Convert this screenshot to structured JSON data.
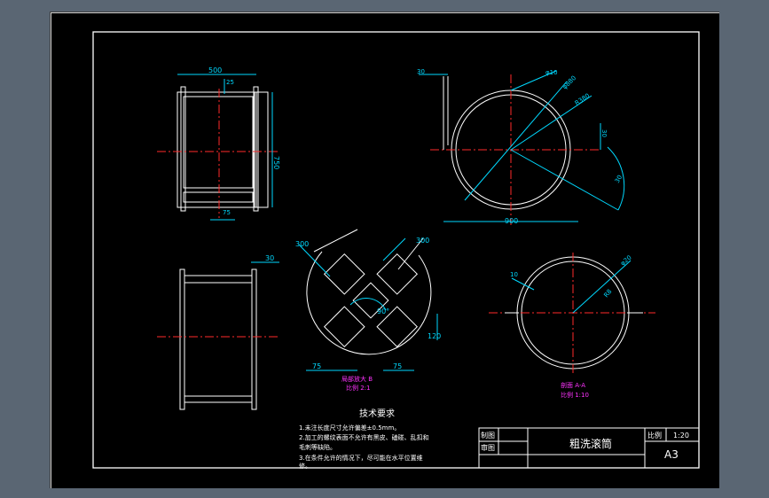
{
  "title_block": {
    "part_name": "粗洗滚筒",
    "drawn_label": "制图",
    "checked_label": "审图",
    "scale_label": "比例",
    "scale_value": "1:20",
    "sheet_size": "A3"
  },
  "tech_req": {
    "heading": "技术要求",
    "line1": "1.未注长度尺寸允许偏差±0.5mm。",
    "line2": "2.加工的螺纹表面不允许有黑皮、磕碰、乱扣和",
    "line3": "毛刺等缺陷。",
    "line4": "3.在条件允许的情况下，尽可能在水平位置维",
    "line5": "修。"
  },
  "dims": {
    "front_width": "500",
    "front_height": "750",
    "front_top_small": "25",
    "front_bottom_small": "75",
    "side_offset": "30",
    "ring_left_offset": "30",
    "ring_d_small": "φ10",
    "ring_d_mid": "φ880",
    "ring_r": "R380",
    "ring_right_30": "30",
    "ring_arc_30": "30",
    "ring_width": "900",
    "plate_w_left": "300",
    "plate_w_right": "300",
    "plate_angle": "90°",
    "plate_offset": "120",
    "plate_bot_left": "75",
    "plate_bot_right": "75",
    "ring2_left": "10",
    "ring2_d": "φ20",
    "ring2_r": "R8"
  },
  "notes": {
    "plate_label_1": "局部放大 B",
    "plate_label_2": "比例 2:1",
    "section_label_1": "剖面 A-A",
    "section_label_2": "比例 1:10"
  },
  "colors": {
    "sheet": "#000000",
    "lines": "#ffffff",
    "dimensions": "#00d9ff",
    "centerlines": "#ff2a2a",
    "annotations": "#ff33ff"
  }
}
